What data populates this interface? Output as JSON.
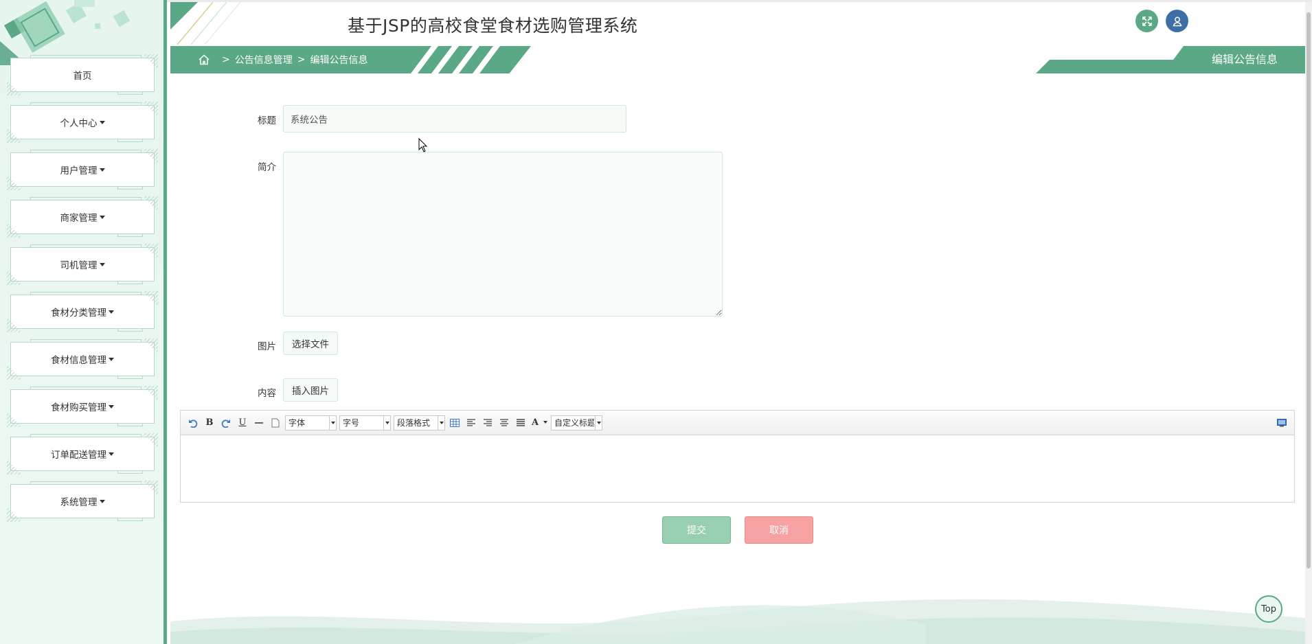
{
  "header": {
    "app_title": "基于JSP的高校食堂食材选购管理系统",
    "fullscreen_icon": "expand-icon",
    "user_icon": "user-icon"
  },
  "sidebar": {
    "items": [
      {
        "label": "首页",
        "has_caret": false
      },
      {
        "label": "个人中心",
        "has_caret": true
      },
      {
        "label": "用户管理",
        "has_caret": true
      },
      {
        "label": "商家管理",
        "has_caret": true
      },
      {
        "label": "司机管理",
        "has_caret": true
      },
      {
        "label": "食材分类管理",
        "has_caret": true
      },
      {
        "label": "食材信息管理",
        "has_caret": true
      },
      {
        "label": "食材购买管理",
        "has_caret": true
      },
      {
        "label": "订单配送管理",
        "has_caret": true
      },
      {
        "label": "系统管理",
        "has_caret": true
      }
    ]
  },
  "breadcrumb": {
    "sep": ">",
    "items": [
      "公告信息管理",
      "编辑公告信息"
    ]
  },
  "page_title": "编辑公告信息",
  "form": {
    "title_label": "标题",
    "title_value": "系统公告",
    "intro_label": "简介",
    "intro_value": "",
    "image_label": "图片",
    "image_button": "选择文件",
    "content_label": "内容",
    "content_button": "插入图片"
  },
  "editor": {
    "font_select": "字体",
    "size_select": "字号",
    "paragraph_select": "段落格式",
    "custom_title_select": "自定义标题",
    "bold": "B",
    "underline": "U",
    "font_color": "A"
  },
  "actions": {
    "submit": "提交",
    "cancel": "取消"
  },
  "back_to_top": "Top",
  "colors": {
    "accent": "#5aa886",
    "user_button": "#3d6fa6",
    "submit": "#97cfb0",
    "cancel": "#f6a2a2"
  }
}
